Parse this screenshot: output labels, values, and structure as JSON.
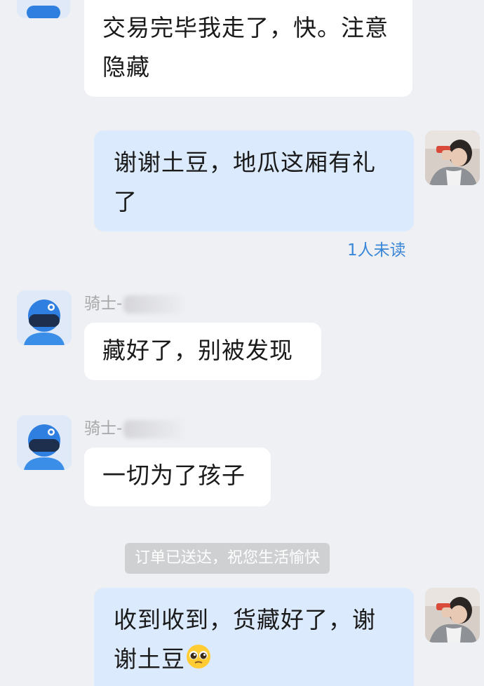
{
  "messages": [
    {
      "id": "m1",
      "direction": "incoming",
      "text": "交易完毕我走了，快。注意隐藏"
    },
    {
      "id": "m2",
      "direction": "outgoing",
      "text": "谢谢土豆，地瓜这厢有礼了",
      "read_status": "1人未读"
    },
    {
      "id": "m3",
      "direction": "incoming",
      "sender": "骑士-",
      "text": "藏好了，别被发现"
    },
    {
      "id": "m4",
      "direction": "incoming",
      "sender": "骑士-",
      "text": "一切为了孩子"
    },
    {
      "id": "m5",
      "direction": "outgoing",
      "text": "收到收到，货藏好了，谢谢土豆",
      "emoji": "pleading-face-emoji"
    }
  ],
  "system_notice": "订单已送达，祝您生活愉快",
  "colors": {
    "background": "#eef0f4",
    "incoming_bubble": "#ffffff",
    "outgoing_bubble": "#dbeafc",
    "read_status": "#3a87d8",
    "rider_helmet": "#2f7fe0",
    "system_notice_bg": "#cfd0d2"
  },
  "icons": {
    "rider_avatar": "rider-avatar-icon",
    "user_avatar": "user-avatar-photo"
  }
}
